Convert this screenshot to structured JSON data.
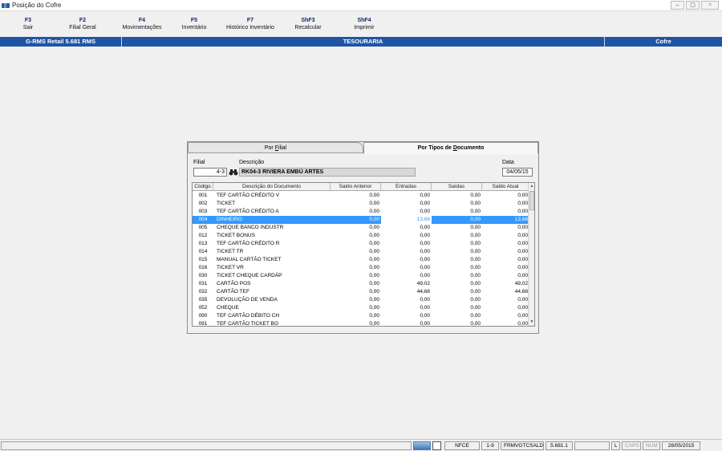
{
  "window": {
    "title": "Posição do Cofre"
  },
  "toolbar": [
    {
      "key": "F3",
      "label": "Sair"
    },
    {
      "key": "F2",
      "label": "Filial Geral"
    },
    {
      "key": "F4",
      "label": "Movimentações"
    },
    {
      "key": "F5",
      "label": "Inventário"
    },
    {
      "key": "F7",
      "label": "Histórico Inventário"
    },
    {
      "key": "ShF3",
      "label": "Recalcular"
    },
    {
      "key": "ShF4",
      "label": "Imprimir"
    }
  ],
  "header": {
    "system": "G-RMS Retail 5.681 RMS",
    "module": "TESOURARIA",
    "context": "Cofre"
  },
  "tabs": {
    "tab1": "Por Filial",
    "tab2": "Por Tipos de Documento"
  },
  "filter": {
    "filial_label": "Filial",
    "filial_value": "4-3",
    "descricao_label": "Descrição",
    "descricao_value": "RK04-3 RIVIERA EMBÚ ARTES",
    "data_label": "Data",
    "data_value": "04/05/15"
  },
  "grid": {
    "columns": [
      "Código",
      "Descrição do Documento",
      "Saldo Anterior",
      "Entradas",
      "Saídas",
      "Saldo Atual"
    ],
    "rows": [
      [
        "001",
        "TEF CARTÃO CRÉDITO V",
        "0,00",
        "0,00",
        "0,00",
        "0,00"
      ],
      [
        "002",
        "TICKET",
        "0,00",
        "0,00",
        "0,00",
        "0,00"
      ],
      [
        "003",
        "TEF CARTÃO CRÉDITO A",
        "0,00",
        "0,00",
        "0,00",
        "0,00"
      ],
      [
        "004",
        "DINHEIRO",
        "0,00",
        "13,68",
        "0,00",
        "13,68"
      ],
      [
        "005",
        "CHEQUE BANCO INDUSTR",
        "0,00",
        "0,00",
        "0,00",
        "0,00"
      ],
      [
        "012",
        "TICKET BONUS",
        "0,00",
        "0,00",
        "0,00",
        "0,00"
      ],
      [
        "013",
        "TEF CARTÃO CRÉDITO R",
        "0,00",
        "0,00",
        "0,00",
        "0,00"
      ],
      [
        "014",
        "TICKET TR",
        "0,00",
        "0,00",
        "0,00",
        "0,00"
      ],
      [
        "015",
        "MANUAL CARTÃO TICKET",
        "0,00",
        "0,00",
        "0,00",
        "0,00"
      ],
      [
        "016",
        "TICKET VR",
        "0,00",
        "0,00",
        "0,00",
        "0,00"
      ],
      [
        "030",
        "TICKET CHEQUE CARDÁP",
        "0,00",
        "0,00",
        "0,00",
        "0,00"
      ],
      [
        "031",
        "CARTÃO POS",
        "0,00",
        "49,02",
        "0,00",
        "49,02"
      ],
      [
        "032",
        "CARTÃO TEF",
        "0,00",
        "44,68",
        "0,00",
        "44,68"
      ],
      [
        "035",
        "DEVOLUÇÃO DE VENDA",
        "0,00",
        "0,00",
        "0,00",
        "0,00"
      ],
      [
        "052",
        "CHEQUE",
        "0,00",
        "0,00",
        "0,00",
        "0,00"
      ],
      [
        "090",
        "TEF CARTÃO DÉBITO CH",
        "0,00",
        "0,00",
        "0,00",
        "0,00"
      ],
      [
        "091",
        "TEF CARTÃO TICKET BO",
        "0,00",
        "0,00",
        "0,00",
        "0,00"
      ]
    ],
    "selected_row": 3
  },
  "statusbar": {
    "nfce": "NFCE",
    "range": "1-9",
    "program": "FRMVGTCSALD",
    "version": "5.681.1",
    "l": "L",
    "caps": "CAPS",
    "num": "NUM",
    "date": "28/05/2015"
  },
  "colors": {
    "header_blue": "#1f55a4",
    "selection": "#3399ff"
  }
}
